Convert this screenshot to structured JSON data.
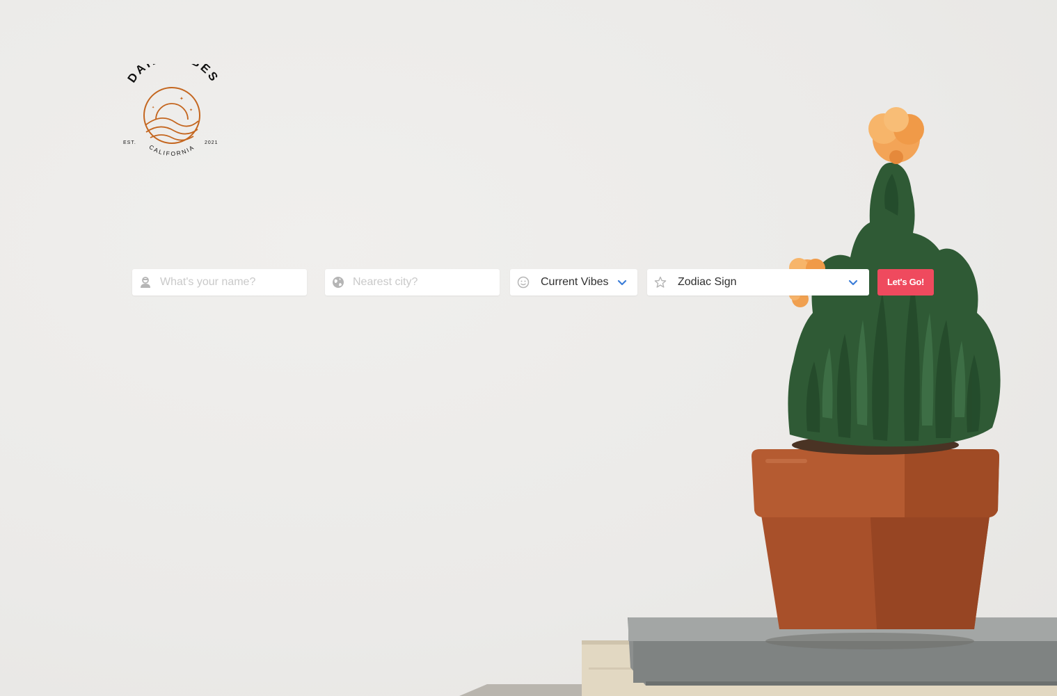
{
  "brand": {
    "logo_text_top": "DAILY VIBES",
    "logo_text_left": "EST.",
    "logo_text_right": "2021",
    "logo_text_bottom": "CALIFORNIA",
    "logo_color": "#c4661f"
  },
  "form": {
    "name_field": {
      "placeholder": "What's your name?",
      "value": "",
      "icon": "user-icon"
    },
    "city_field": {
      "placeholder": "Nearest city?",
      "value": "",
      "icon": "globe-icon"
    },
    "vibes_select": {
      "selected": "Current Vibes",
      "icon": "smiley-icon"
    },
    "zodiac_select": {
      "selected": "Zodiac Sign",
      "icon": "star-icon"
    },
    "submit_label": "Let's Go!"
  },
  "colors": {
    "background": "#edecea",
    "button": "#ef4a5e",
    "chevron": "#3b7dd8",
    "icon_gray": "#b5b5b5"
  }
}
